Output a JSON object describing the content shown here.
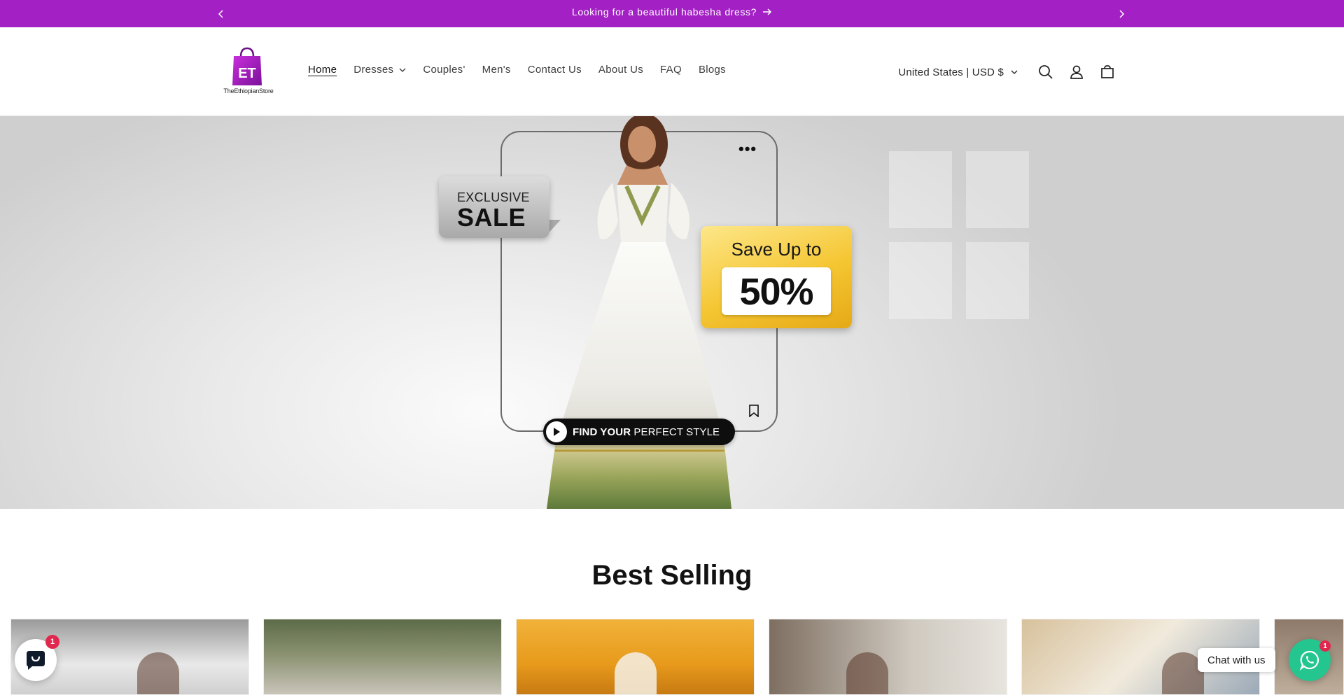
{
  "announcement": {
    "message": "Looking for a beautiful habesha dress?",
    "prev_icon": "chevron-left-icon",
    "next_icon": "chevron-right-icon",
    "arrow_icon": "arrow-right-icon",
    "background": "#a321c4"
  },
  "header": {
    "logo_mark": "ET",
    "logo_text": "TheEthiopianStore",
    "nav": [
      {
        "label": "Home",
        "active": true
      },
      {
        "label": "Dresses",
        "has_dropdown": true
      },
      {
        "label": "Couples'"
      },
      {
        "label": "Men's"
      },
      {
        "label": "Contact Us"
      },
      {
        "label": "About Us"
      },
      {
        "label": "FAQ"
      },
      {
        "label": "Blogs"
      }
    ],
    "locale": "United States | USD $",
    "icons": [
      "search-icon",
      "account-icon",
      "cart-icon"
    ]
  },
  "hero": {
    "sale_line1": "EXCLUSIVE",
    "sale_line2": "SALE",
    "save_line1": "Save Up to",
    "save_line2": "50%",
    "cta_bold": "FIND YOUR",
    "cta_rest": " PERFECT STYLE",
    "menu_dots": "•••"
  },
  "section": {
    "title": "Best Selling"
  },
  "chat": {
    "shop_badge": "1",
    "whatsapp_label": "Chat with us",
    "whatsapp_badge": "1",
    "whatsapp_color": "#25c58f"
  }
}
